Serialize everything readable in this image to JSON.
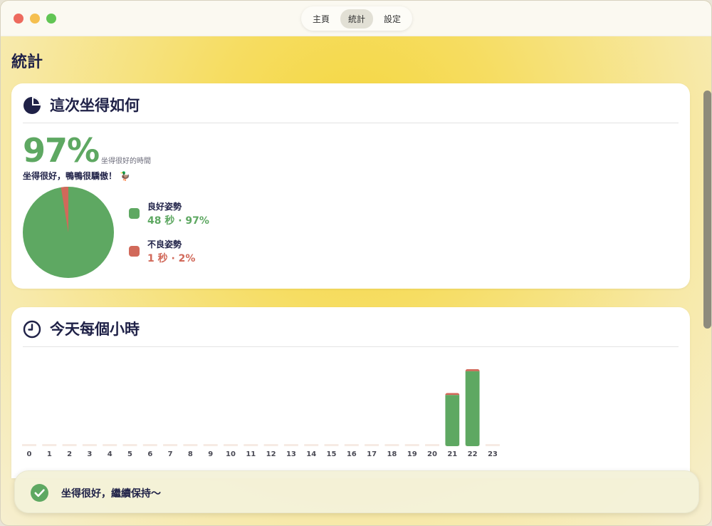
{
  "tabs": [
    {
      "label": "主頁",
      "active": false
    },
    {
      "label": "統計",
      "active": true
    },
    {
      "label": "設定",
      "active": false
    }
  ],
  "page_title": "統計",
  "session_card": {
    "title": "這次坐得如何",
    "icon": "pie-chart-icon",
    "percent": "97%",
    "percent_caption": "坐得很好的時間",
    "message": "坐得很好，鴨鴨很驕傲！ 🦆",
    "legend": [
      {
        "name": "良好姿勢",
        "value_text": "48 秒 · 97%",
        "color": "#5ea862"
      },
      {
        "name": "不良姿勢",
        "value_text": "1 秒 · 2%",
        "color": "#d1695a"
      }
    ]
  },
  "hourly_card": {
    "title": "今天每個小時",
    "icon": "clock-icon"
  },
  "chart_data": {
    "type": "bar",
    "stacked": true,
    "categories": [
      "0",
      "1",
      "2",
      "3",
      "4",
      "5",
      "6",
      "7",
      "8",
      "9",
      "10",
      "11",
      "12",
      "13",
      "14",
      "15",
      "16",
      "17",
      "18",
      "19",
      "20",
      "21",
      "22",
      "23"
    ],
    "series": [
      {
        "name": "良好姿勢",
        "color": "#5ea862",
        "values": [
          0,
          0,
          0,
          0,
          0,
          0,
          0,
          0,
          0,
          0,
          0,
          0,
          0,
          0,
          0,
          0,
          0,
          0,
          0,
          0,
          0,
          73,
          107,
          0
        ]
      },
      {
        "name": "不良姿勢",
        "color": "#d1695a",
        "values": [
          0,
          0,
          0,
          0,
          0,
          0,
          0,
          0,
          0,
          0,
          0,
          0,
          0,
          0,
          0,
          0,
          0,
          0,
          0,
          0,
          0,
          3,
          3,
          0
        ]
      }
    ],
    "ylim": [
      0,
      115
    ],
    "empty_slot_color": "#f6ebe4"
  },
  "toast": {
    "text": "坐得很好，繼續保持～",
    "icon": "check-circle-icon",
    "color": "#5ea862"
  },
  "colors": {
    "accent_green": "#5ea862",
    "accent_red": "#d1695a",
    "navy": "#1f2147"
  }
}
